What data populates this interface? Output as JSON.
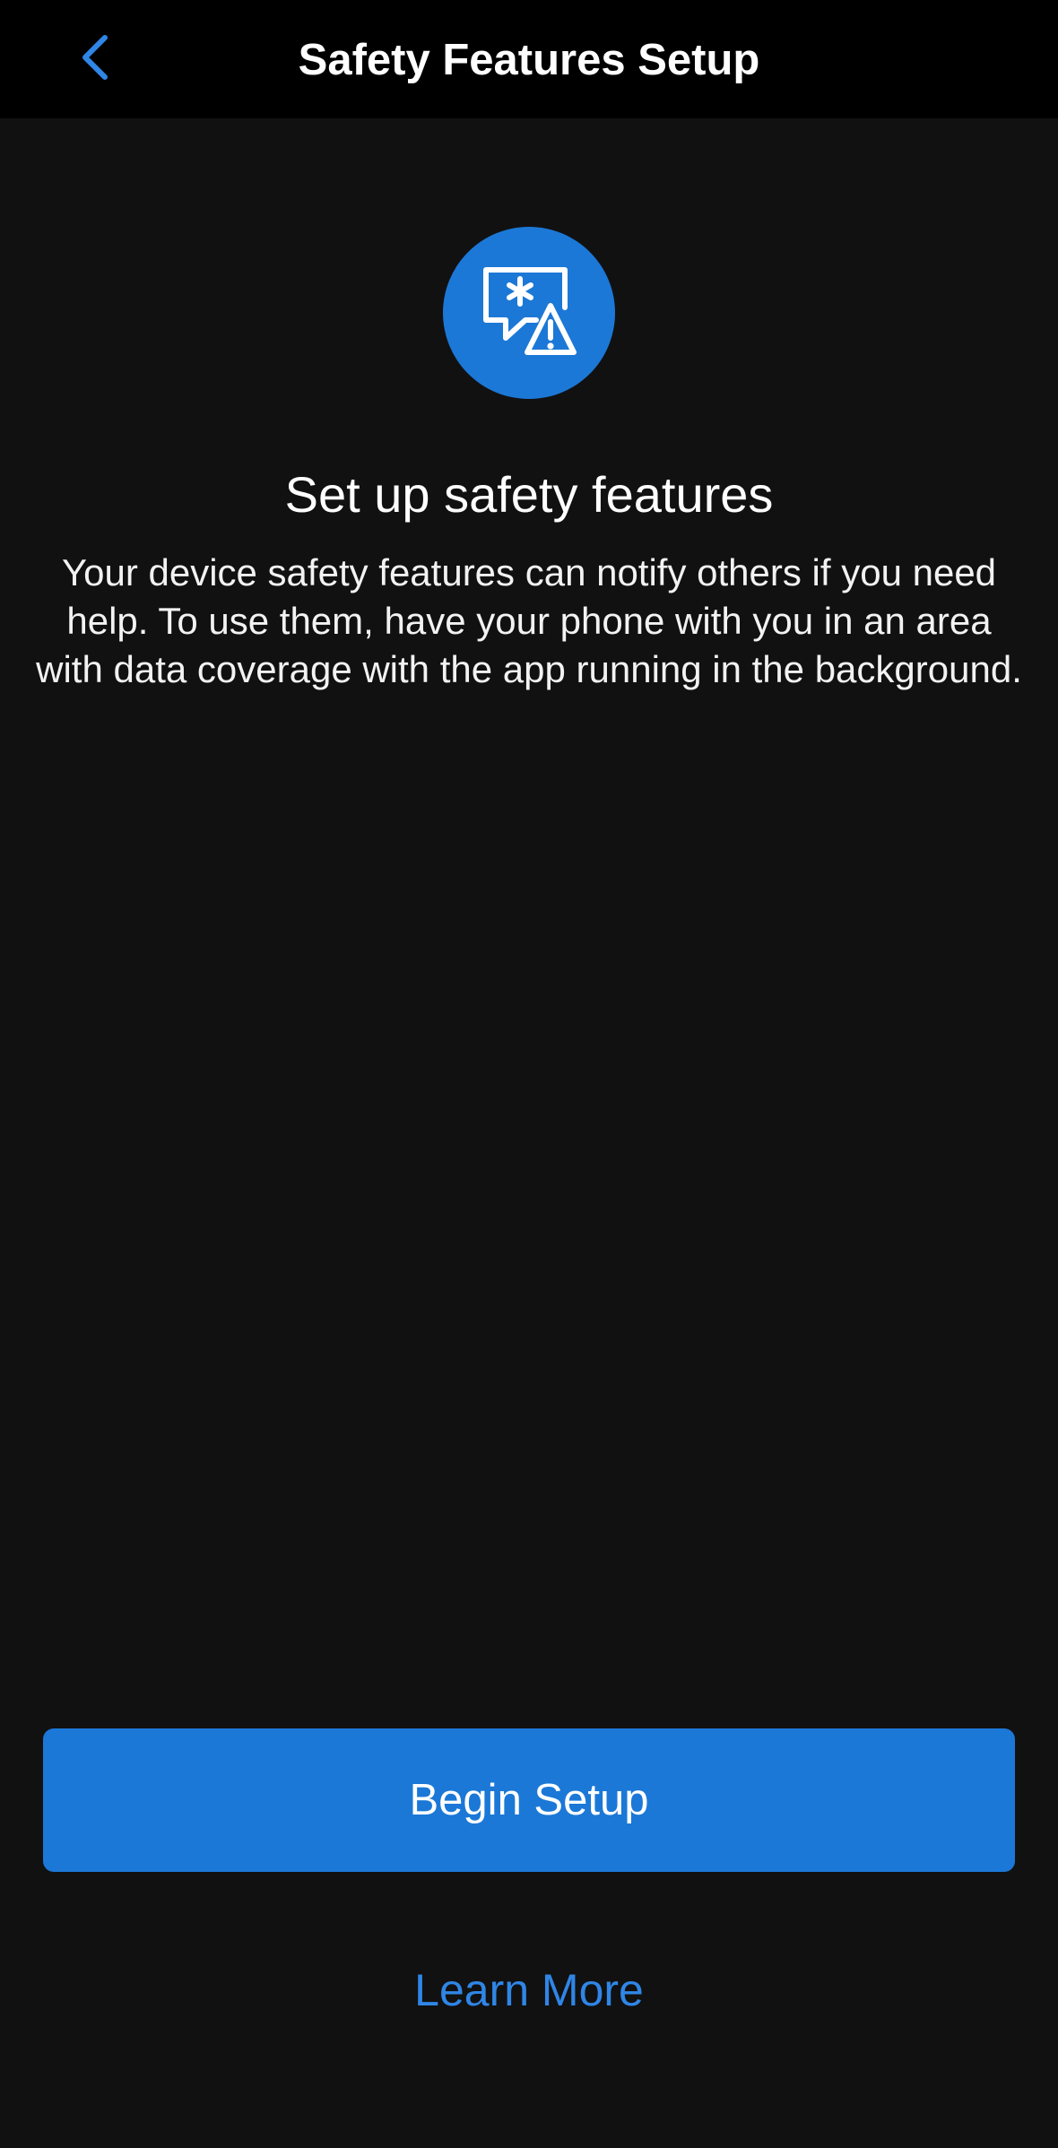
{
  "nav": {
    "title": "Safety Features Setup",
    "back_icon": "chevron-left-icon"
  },
  "hero": {
    "icon": "emergency-alert-icon",
    "headline": "Set up safety features",
    "description": "Your device safety features can notify others if you need help. To use them, have your phone with you in an area with data coverage with the app running in the background."
  },
  "actions": {
    "begin_setup_label": "Begin Setup",
    "learn_more_label": "Learn More"
  },
  "colors": {
    "background": "#111112",
    "nav_background": "#000000",
    "accent": "#1b78d7",
    "link": "#2f86e6"
  }
}
